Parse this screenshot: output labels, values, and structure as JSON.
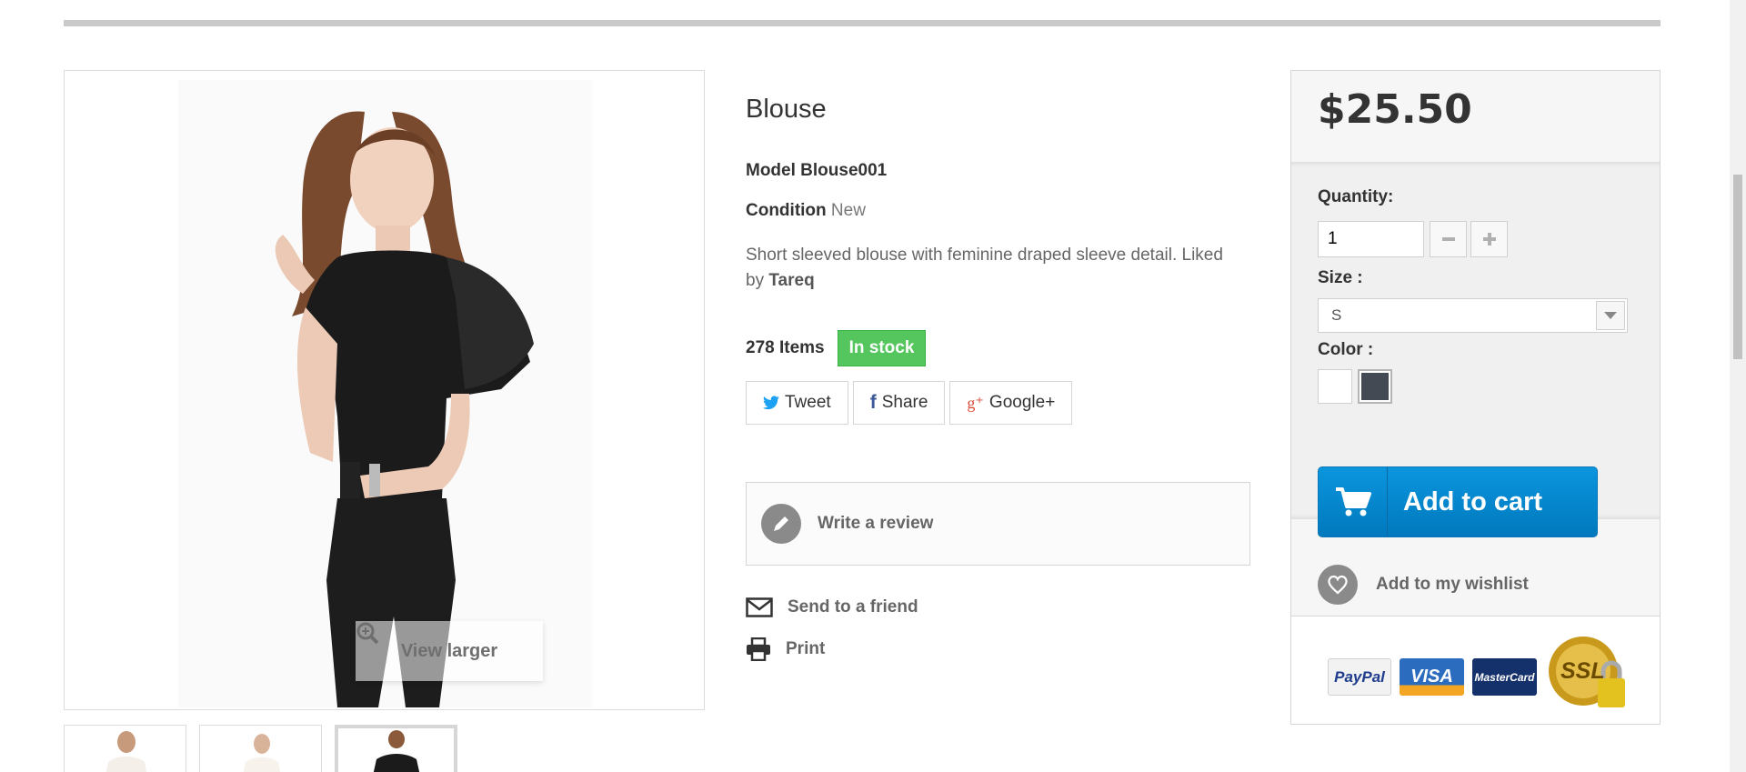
{
  "product": {
    "title": "Blouse",
    "model_label": "Model",
    "model_value": "Blouse001",
    "condition_label": "Condition",
    "condition_value": "New",
    "description_text": "Short sleeved blouse with feminine draped sleeve detail. Liked by",
    "description_user": "Tareq",
    "items_count": "278 Items",
    "stock_status": "In stock"
  },
  "image": {
    "view_larger": "View larger",
    "thumbnails": [
      "thumbnail-1",
      "thumbnail-2",
      "thumbnail-3"
    ],
    "active_thumbnail": 3
  },
  "social": {
    "tweet": "Tweet",
    "share": "Share",
    "google": "Google+"
  },
  "actions": {
    "write_review": "Write a review",
    "send_friend": "Send to a friend",
    "print": "Print"
  },
  "buybox": {
    "price": "$25.50",
    "quantity_label": "Quantity:",
    "quantity_value": "1",
    "size_label": "Size :",
    "size_value": "S",
    "color_label": "Color :",
    "colors": [
      "#ffffff",
      "#434a54"
    ],
    "selected_color": 2,
    "add_to_cart": "Add to cart",
    "add_to_wishlist": "Add to my wishlist"
  },
  "payments": {
    "paypal": "PayPal",
    "visa": "VISA",
    "mastercard": "MasterCard",
    "ssl": "SSL"
  },
  "colors": {
    "in_stock": "#55c65e",
    "cart_button": "#0a8ccf",
    "text_dark": "#333333",
    "text_muted": "#666666"
  }
}
